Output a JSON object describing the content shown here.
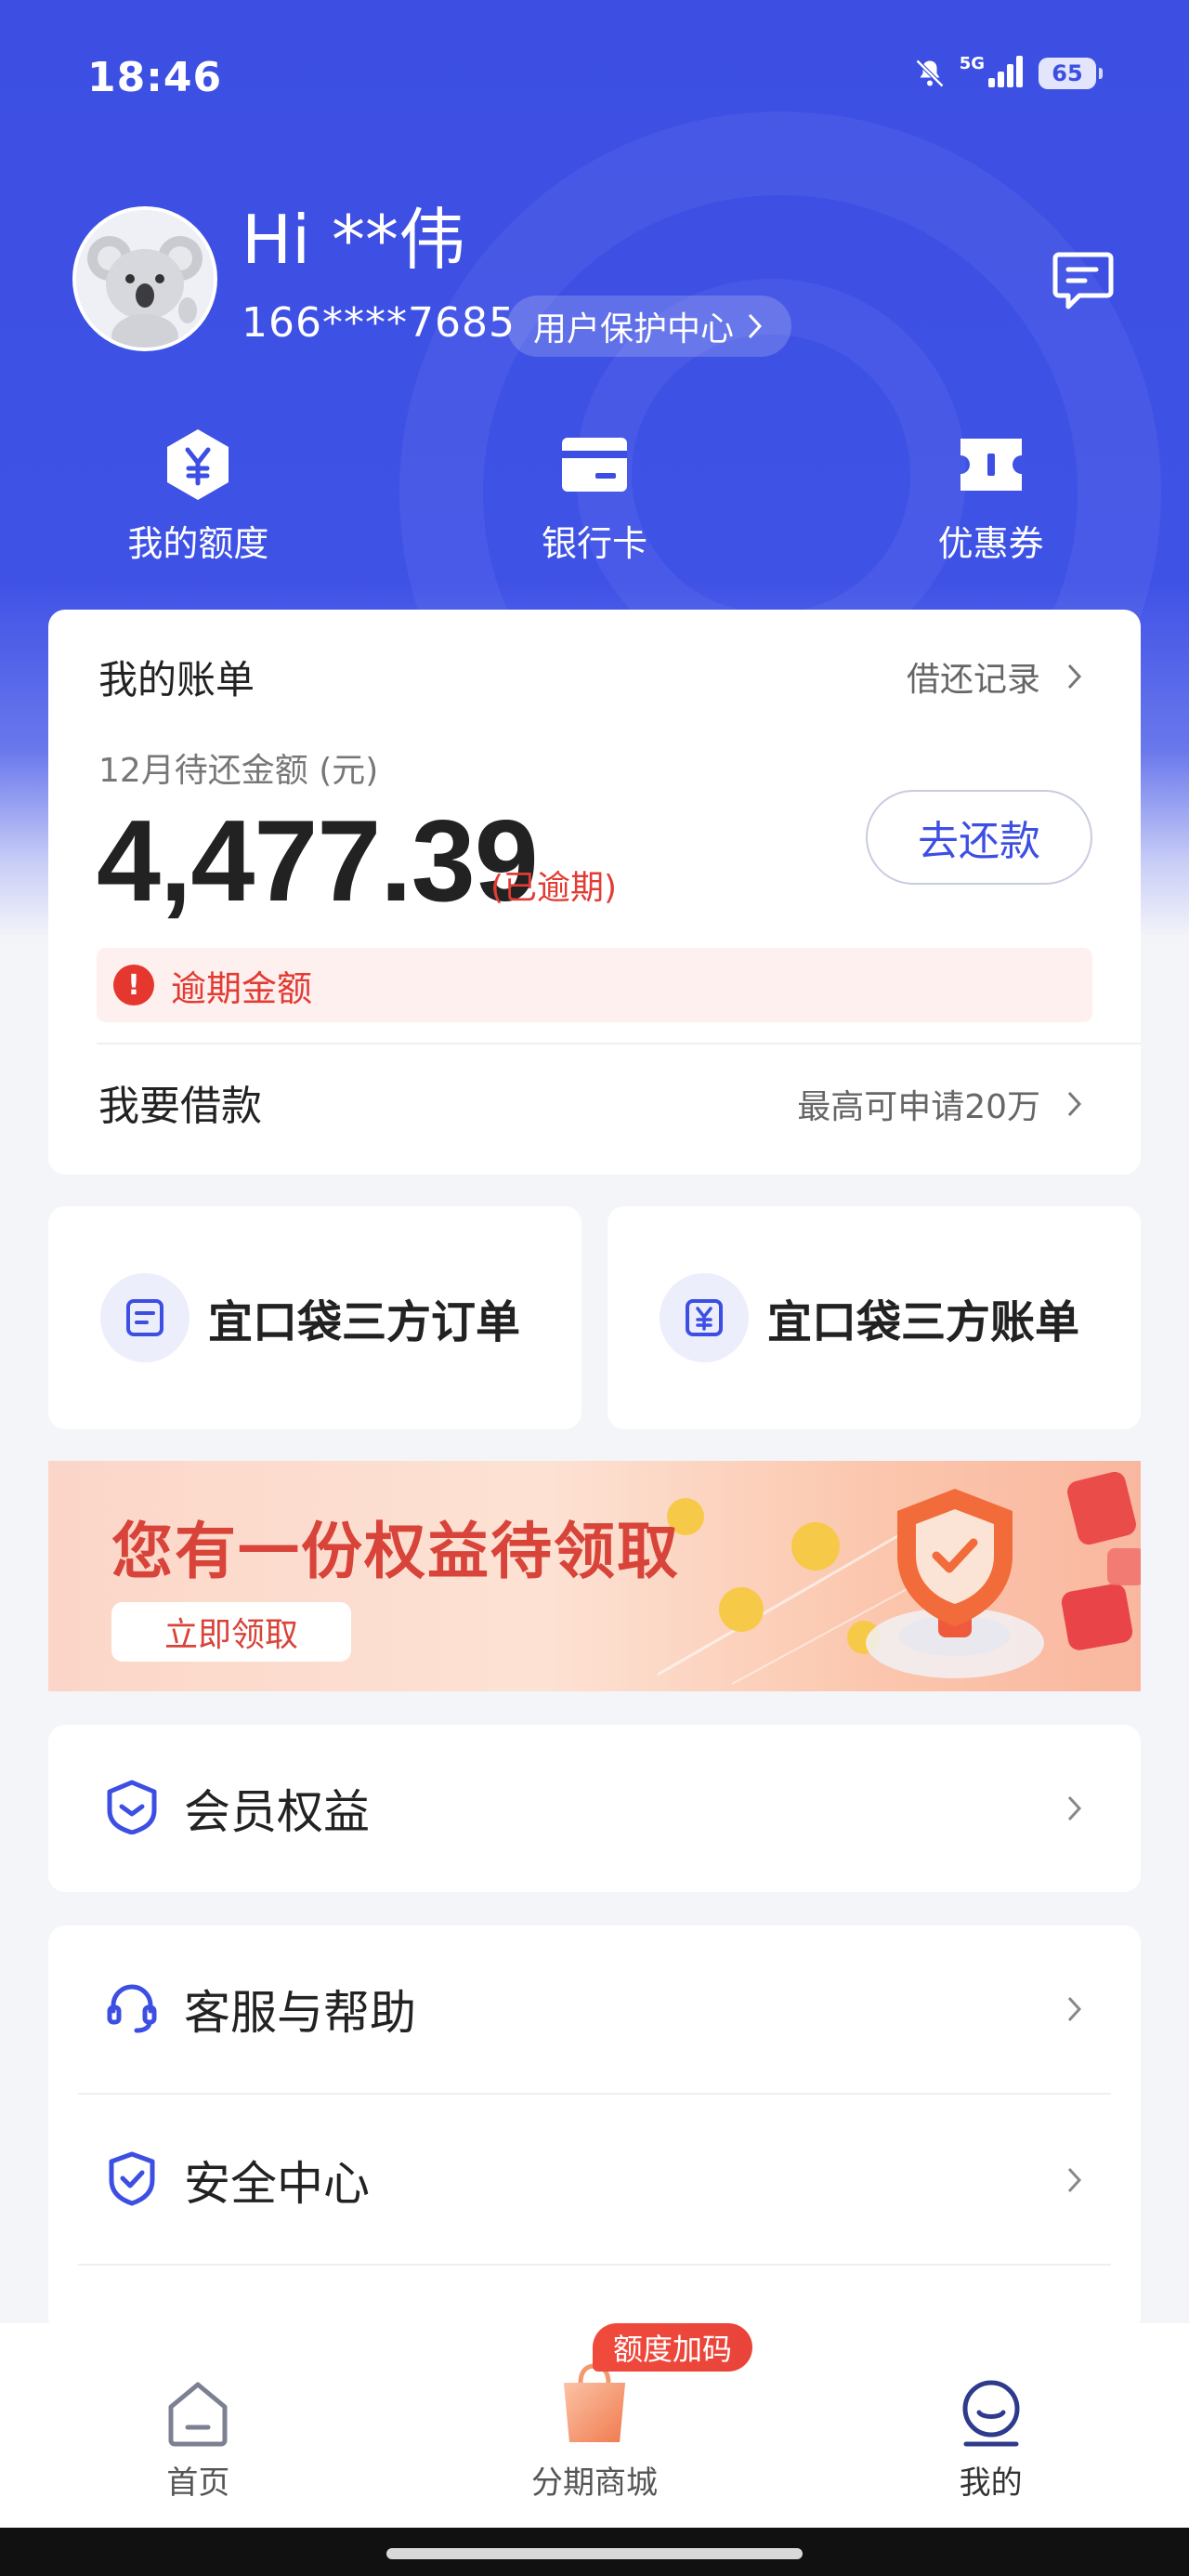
{
  "status_bar": {
    "time": "18:46",
    "network": "5G",
    "battery": "65"
  },
  "profile": {
    "greeting": "Hi **伟",
    "phone": "166****7685",
    "protect_center": "用户保护中心"
  },
  "quick_actions": [
    {
      "label": "我的额度",
      "icon": "yuan-hexagon-icon"
    },
    {
      "label": "银行卡",
      "icon": "bank-card-icon"
    },
    {
      "label": "优惠券",
      "icon": "coupon-icon"
    }
  ],
  "bill": {
    "title": "我的账单",
    "records_link": "借还记录",
    "due_label": "12月待还金额 (元)",
    "amount": "4,477.39",
    "overdue_tag": "(已逾期)",
    "repay_button": "去还款",
    "overdue_notice": "逾期金额",
    "borrow_title": "我要借款",
    "borrow_hint": "最高可申请20万"
  },
  "third_party": [
    {
      "label": "宜口袋三方订单",
      "icon": "order-doc-icon"
    },
    {
      "label": "宜口袋三方账单",
      "icon": "yuan-bill-icon"
    }
  ],
  "banner": {
    "title": "您有一份权益待领取",
    "button": "立即领取"
  },
  "menu": {
    "member": "会员权益",
    "service": "客服与帮助",
    "security": "安全中心"
  },
  "tabbar": {
    "home": "首页",
    "mall": "分期商城",
    "mine": "我的",
    "promo_badge": "额度加码"
  },
  "colors": {
    "brand_blue": "#3d4fe3",
    "alert_red": "#e23b33",
    "banner_red": "#d8433a"
  }
}
